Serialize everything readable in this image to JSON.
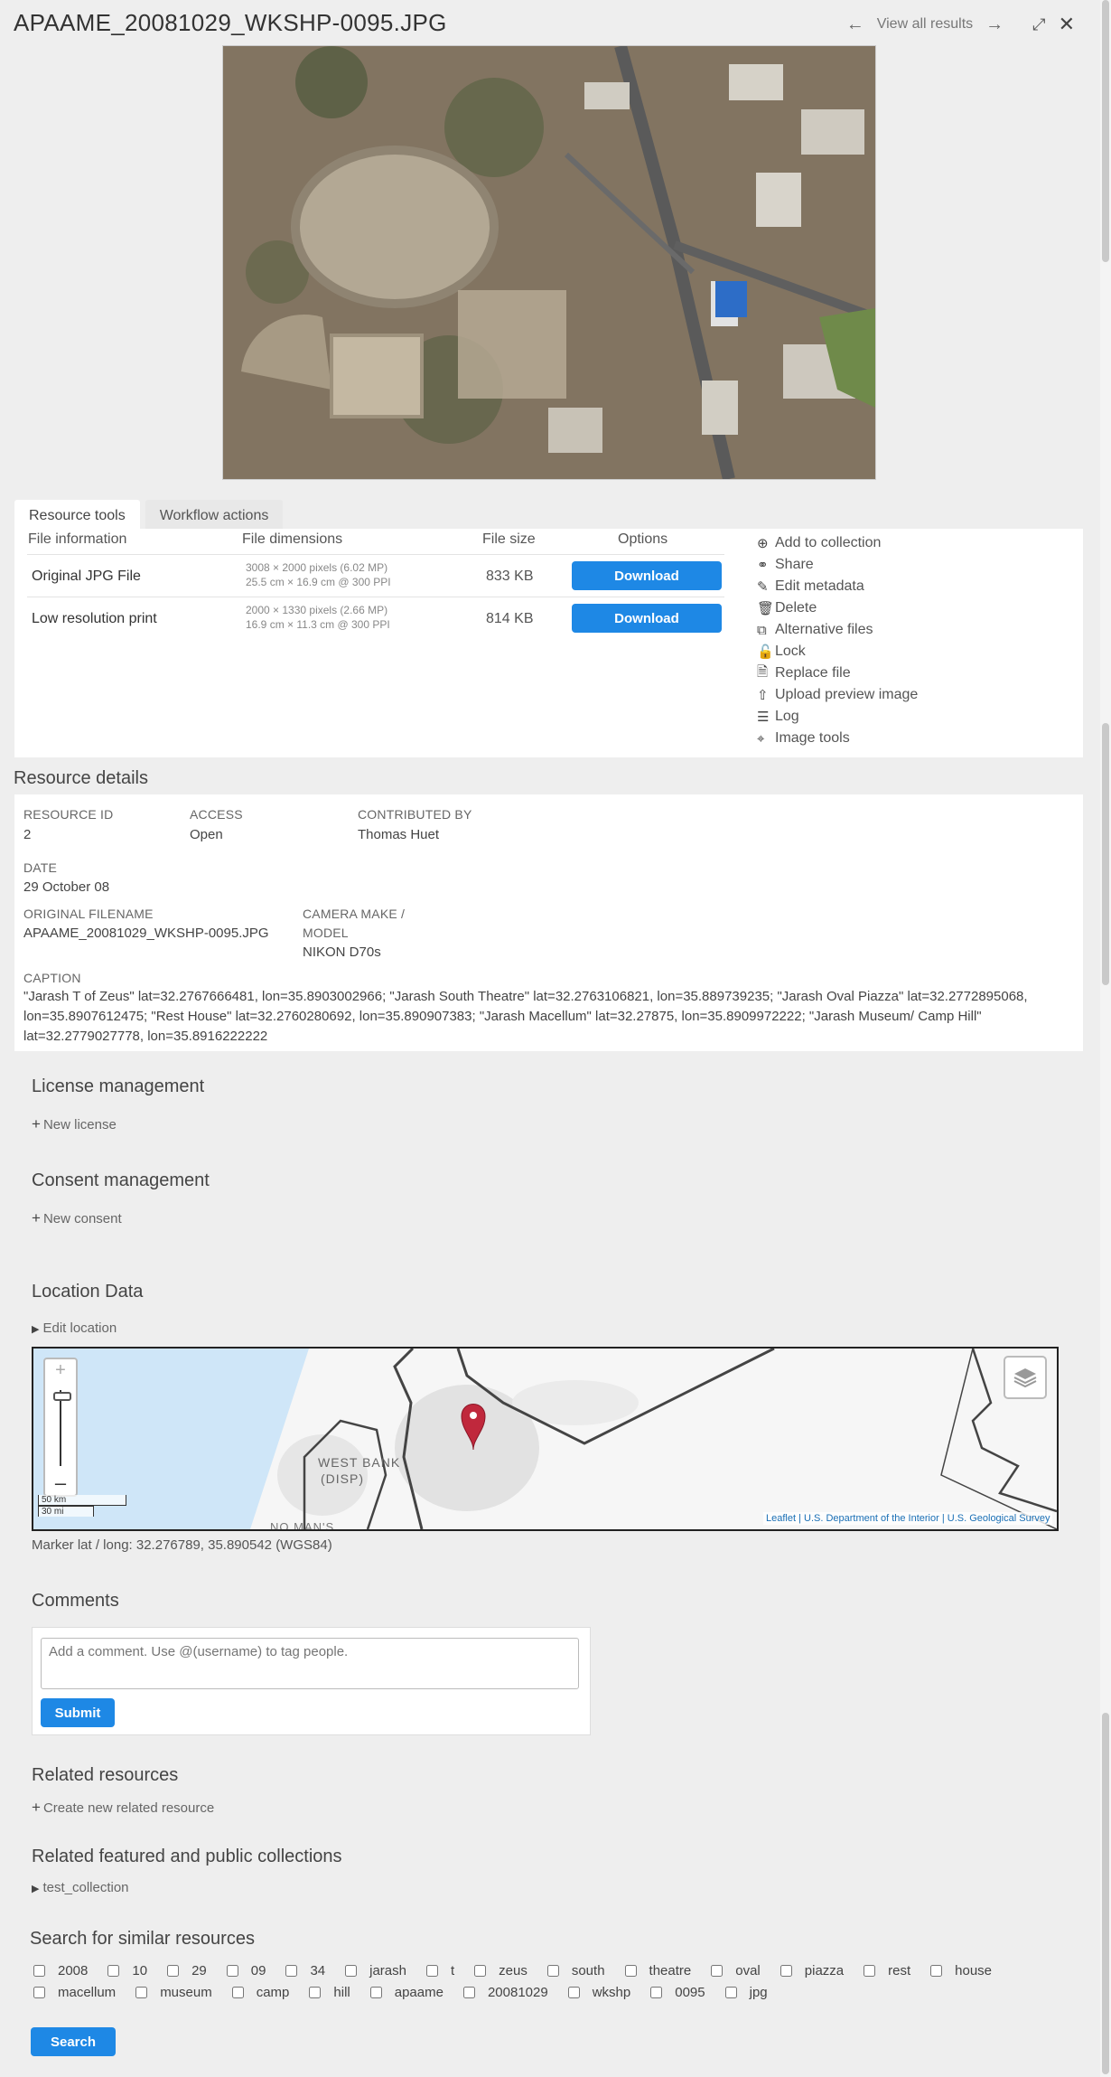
{
  "header": {
    "title": "APAAME_20081029_WKSHP-0095.JPG",
    "view_all": "View all results"
  },
  "tabs": [
    "Resource tools",
    "Workflow actions"
  ],
  "file_table": {
    "headers": [
      "File information",
      "File dimensions",
      "File size",
      "Options"
    ],
    "rows": [
      {
        "name": "Original JPG File",
        "dim1": "3008 × 2000 pixels (6.02 MP)",
        "dim2": "25.5 cm × 16.9 cm @ 300 PPI",
        "size": "833 KB",
        "button": "Download"
      },
      {
        "name": "Low resolution print",
        "dim1": "2000 × 1330 pixels (2.66 MP)",
        "dim2": "16.9 cm × 11.3 cm @ 300 PPI",
        "size": "814 KB",
        "button": "Download"
      }
    ]
  },
  "actions": [
    {
      "label": "Add to collection",
      "icon": "plus-circle-icon"
    },
    {
      "label": "Share",
      "icon": "share-icon"
    },
    {
      "label": "Edit metadata",
      "icon": "pencil-icon"
    },
    {
      "label": "Delete",
      "icon": "trash-icon"
    },
    {
      "label": "Alternative files",
      "icon": "copy-icon"
    },
    {
      "label": "Lock",
      "icon": "lock-icon"
    },
    {
      "label": "Replace file",
      "icon": "file-replace-icon"
    },
    {
      "label": "Upload preview image",
      "icon": "upload-icon"
    },
    {
      "label": "Log",
      "icon": "list-icon"
    },
    {
      "label": "Image tools",
      "icon": "crop-icon"
    }
  ],
  "details": {
    "heading": "Resource details",
    "resource_id_label": "RESOURCE ID",
    "resource_id": "2",
    "access_label": "ACCESS",
    "access": "Open",
    "contributed_label": "CONTRIBUTED BY",
    "contributed": "Thomas Huet",
    "date_label": "DATE",
    "date": "29 October 08",
    "filename_label": "ORIGINAL FILENAME",
    "filename": "APAAME_20081029_WKSHP-0095.JPG",
    "camera_label_1": "CAMERA MAKE /",
    "camera_label_2": "MODEL",
    "camera": "NIKON D70s",
    "caption_label": "CAPTION",
    "caption": "\"Jarash T of Zeus\" lat=32.2767666481, lon=35.8903002966; \"Jarash South Theatre\" lat=32.2763106821, lon=35.889739235; \"Jarash Oval Piazza\" lat=32.2772895068, lon=35.8907612475; \"Rest House\" lat=32.2760280692, lon=35.890907383; \"Jarash Macellum\" lat=32.27875, lon=35.8909972222; \"Jarash Museum/ Camp Hill\" lat=32.2779027778, lon=35.8916222222"
  },
  "license": {
    "heading": "License management",
    "link": "New license"
  },
  "consent": {
    "heading": "Consent management",
    "link": "New consent"
  },
  "location": {
    "heading": "Location Data",
    "edit": "Edit location",
    "map_label_1": "WEST BANK",
    "map_label_2": "(DISP)",
    "map_label_3": "NO MAN'S",
    "scale_km": "50 km",
    "scale_mi": "30 mi",
    "attribution": "Leaflet | U.S. Department of the Interior | U.S. Geological Survey",
    "marker": "Marker lat / long: 32.276789, 35.890542 (WGS84)"
  },
  "comments": {
    "heading": "Comments",
    "placeholder": "Add a comment. Use @(username) to tag people.",
    "submit": "Submit"
  },
  "related": {
    "heading": "Related resources",
    "link": "Create new related resource"
  },
  "collections": {
    "heading": "Related featured and public collections",
    "item": "test_collection"
  },
  "similar": {
    "heading": "Search for similar resources",
    "row1": [
      "2008",
      "10",
      "29",
      "09",
      "34",
      "jarash",
      "t",
      "zeus",
      "south",
      "theatre",
      "oval",
      "piazza",
      "rest",
      "house"
    ],
    "row2": [
      "macellum",
      "museum",
      "camp",
      "hill",
      "apaame",
      "20081029",
      "wkshp",
      "0095",
      "jpg"
    ],
    "button": "Search"
  }
}
